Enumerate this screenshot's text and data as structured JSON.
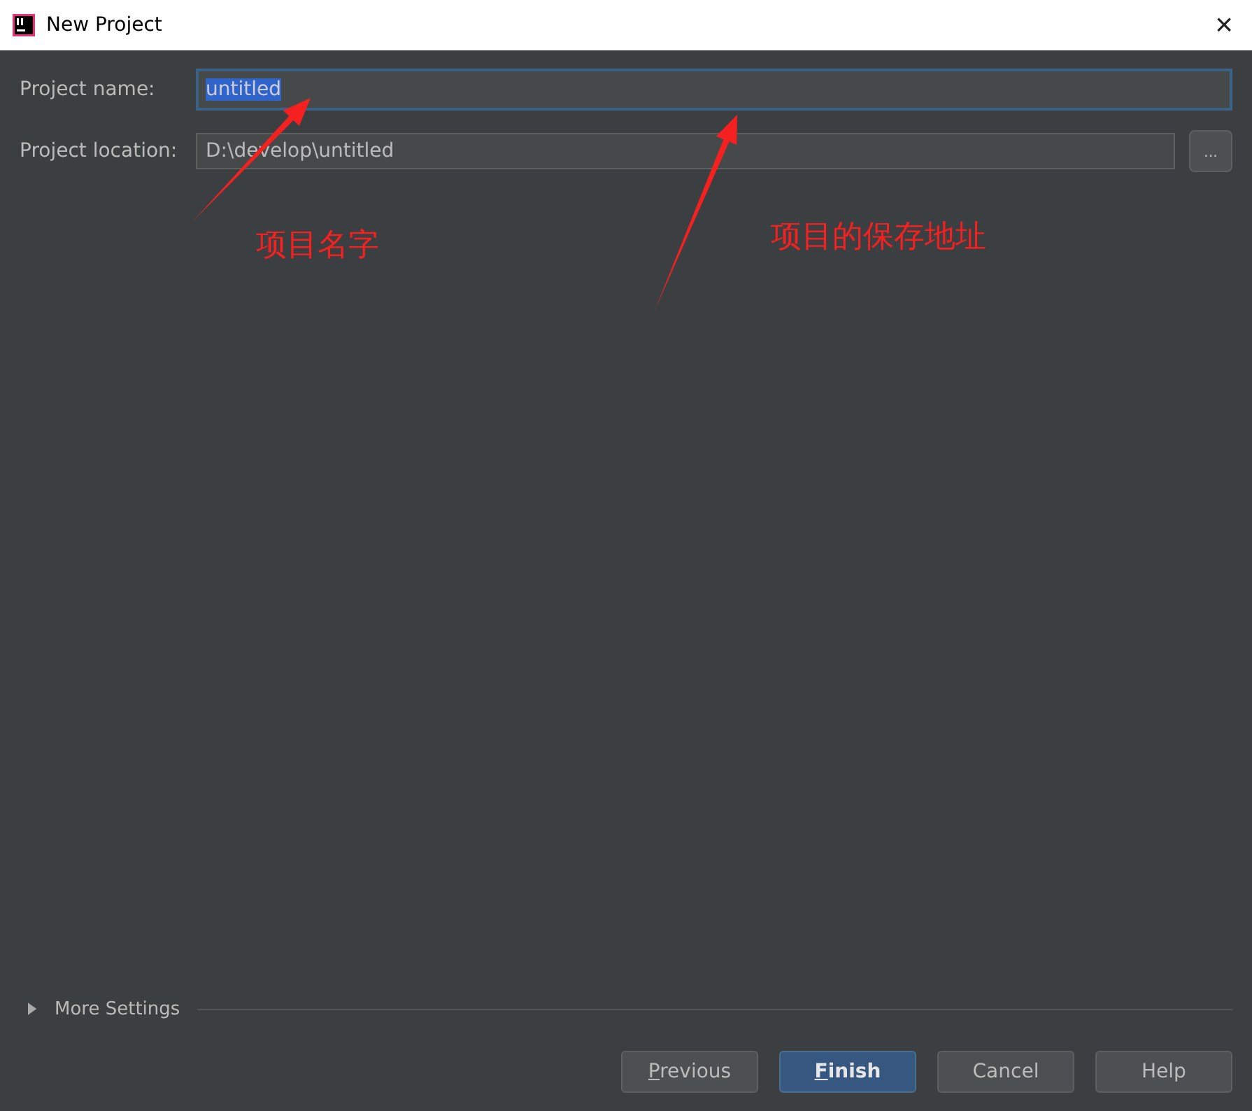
{
  "window": {
    "title": "New Project",
    "close": "×"
  },
  "fields": [
    {
      "label": "Project name:",
      "value": "untitled",
      "focused": true
    },
    {
      "label": "Project location:",
      "value": "D:\\develop\\untitled",
      "focused": false,
      "browse": "..."
    }
  ],
  "annotations": [
    {
      "text": "项目名字"
    },
    {
      "text": "项目的保存地址"
    }
  ],
  "more_settings": {
    "label": "More Settings",
    "expanded": false
  },
  "buttons": [
    {
      "mnemonic": "P",
      "rest": "revious",
      "default": false
    },
    {
      "mnemonic": "F",
      "rest": "inish",
      "default": true
    },
    {
      "rest": "Cancel",
      "default": false
    },
    {
      "rest": "Help",
      "default": false
    }
  ]
}
